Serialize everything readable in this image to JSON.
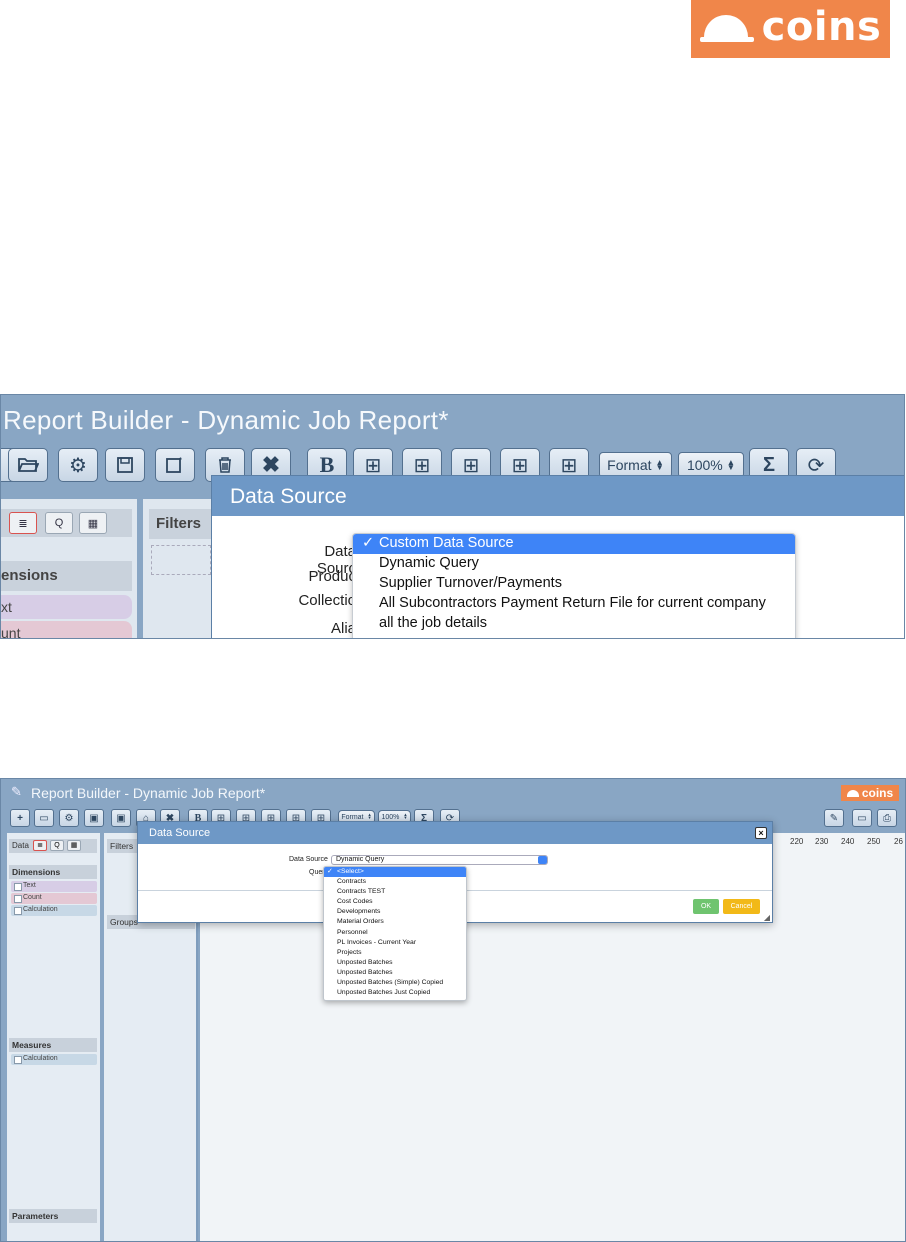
{
  "logo": {
    "text": "coins"
  },
  "zoom": {
    "app_title": "Report Builder -  Dynamic Job Report*",
    "format_select": "Format",
    "zoom_select": "100%",
    "sidebar": {
      "tab_q": "Q",
      "dimensions_header": "ensions",
      "items": [
        "xt",
        "unt"
      ]
    },
    "filters_header": "Filters",
    "dialog": {
      "title": "Data Source",
      "labels": [
        "Data Sourc",
        "Produc",
        "Collectio",
        "Alia"
      ]
    },
    "dropdown": {
      "selected": "Custom Data Source",
      "options": [
        "Dynamic Query",
        "Supplier Turnover/Payments",
        "All Subcontractors Payment Return File for current company",
        "all the job details"
      ]
    }
  },
  "full": {
    "app_title": "Report Builder -  Dynamic Job Report*",
    "brand": "coins",
    "format_select": "Format",
    "zoom_select": "100%",
    "sidebar": {
      "data_label": "Data",
      "tab_q": "Q",
      "dimensions_header": "Dimensions",
      "dimensions": [
        "Text",
        "Count",
        "Calculation"
      ],
      "measures_header": "Measures",
      "measures": [
        "Calculation"
      ],
      "parameters_header": "Parameters"
    },
    "filters_header": "Filters",
    "groups_header": "Groups",
    "ruler": [
      "220",
      "230",
      "240",
      "250",
      "26"
    ],
    "dialog": {
      "title": "Data Source",
      "close": "×",
      "data_source_label": "Data Source",
      "data_source_value": "Dynamic Query",
      "query_label": "Quer",
      "ok": "OK",
      "cancel": "Cancel"
    },
    "query_dropdown": {
      "selected": "<Select>",
      "options": [
        "Contracts",
        "Contracts TEST",
        "Cost Codes",
        "Developments",
        "Material Orders",
        "Personnel",
        "PL Invoices - Current Year",
        "Projects",
        "Unposted Batches",
        "Unposted Batches",
        "Unposted Batches (Simple) Copied",
        "Unposted Batches Just Copied"
      ]
    }
  },
  "colors": {
    "accent": "#f0864a",
    "chrome": "#89a6c4",
    "dialog_header": "#6e98c6",
    "selected": "#3e84f7",
    "ok": "#6fc46f",
    "cancel": "#f2b918"
  }
}
